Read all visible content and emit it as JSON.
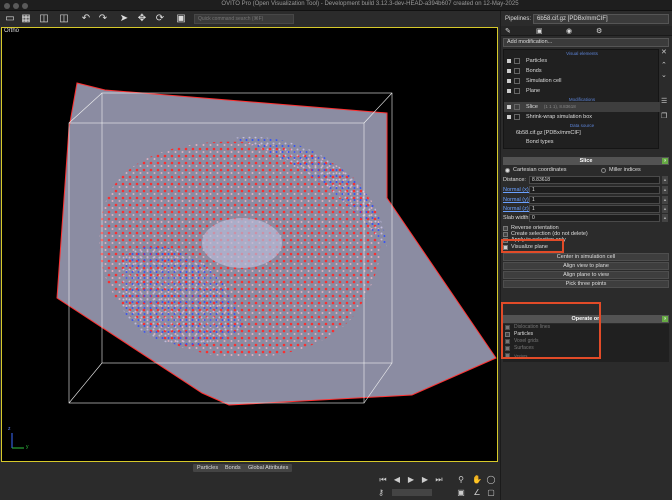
{
  "window": {
    "title": "OVITO Pro (Open Visualization Tool) - Development build 3.12.3-dev-HEAD-a394b607 created on 12-May-2025"
  },
  "toolbar": {
    "icons": [
      "load-file-icon",
      "save-icon",
      "import-icon",
      "export-icon",
      "undo-icon",
      "redo-icon",
      "select-icon",
      "move-icon",
      "rotate-icon",
      "render-icon"
    ],
    "search_placeholder": "Quick command search (⌘F)"
  },
  "viewport": {
    "caption": "Ortho",
    "axes": {
      "z": "z",
      "y": "y"
    },
    "highlight_color": "#d6c92a"
  },
  "bottom_tabs": [
    "Particles",
    "Bonds",
    "Global Attributes"
  ],
  "pipeline": {
    "label": "Pipelines:",
    "selected": "6b58.cif.gz [PDBx/mmCIF]",
    "add_modification": "Add modification...",
    "sections": {
      "visual": "Visual elements",
      "modifications": "Modifications",
      "data_source": "Data source"
    },
    "visual_elements": [
      {
        "label": "Particles",
        "checked": true
      },
      {
        "label": "Bonds",
        "checked": true
      },
      {
        "label": "Simulation cell",
        "checked": true
      },
      {
        "label": "Plane",
        "checked": true
      }
    ],
    "modifications": [
      {
        "label": "Slice",
        "note": "(1 1 1), 8.83618",
        "checked": true,
        "selected": true
      },
      {
        "label": "Shrink-wrap simulation box",
        "checked": true,
        "selected": false
      }
    ],
    "data_source": [
      {
        "label": "6b58.cif.gz [PDBx/mmCIF]"
      },
      {
        "label": "Bond types"
      }
    ]
  },
  "slice": {
    "title": "Slice",
    "help": "?",
    "modes": [
      {
        "label": "Cartesian coordinates",
        "selected": true
      },
      {
        "label": "Miller indices",
        "selected": false
      }
    ],
    "distance": {
      "label": "Distance:",
      "value": "8.83618"
    },
    "normals": [
      {
        "label": "Normal (x):",
        "value": "1"
      },
      {
        "label": "Normal (y):",
        "value": "1"
      },
      {
        "label": "Normal (z):",
        "value": "1"
      }
    ],
    "slab": {
      "label": "Slab width:",
      "value": "0"
    },
    "options": [
      {
        "label": "Reverse orientation",
        "checked": false
      },
      {
        "label": "Create selection (do not delete)",
        "checked": false
      },
      {
        "label": "Apply to selection only",
        "checked": false
      },
      {
        "label": "Visualize plane",
        "checked": true
      }
    ],
    "buttons": [
      "Center in simulation cell",
      "Align view to plane",
      "Align plane to view",
      "Pick three points"
    ]
  },
  "operate_on": {
    "title": "Operate on",
    "items": [
      {
        "label": "Dislocation lines",
        "checked": true,
        "enabled": false
      },
      {
        "label": "Particles",
        "checked": false,
        "enabled": true
      },
      {
        "label": "Voxel grids",
        "checked": true,
        "enabled": false
      },
      {
        "label": "Surfaces",
        "checked": true,
        "enabled": false
      },
      {
        "label": "Vectors",
        "checked": true,
        "enabled": false
      }
    ]
  },
  "highlight_color": "#e24b28"
}
